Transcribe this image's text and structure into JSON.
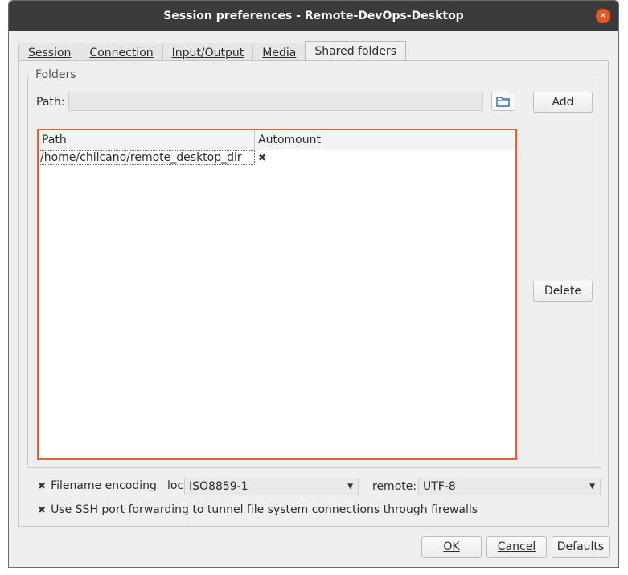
{
  "window": {
    "title": "Session preferences - Remote-DevOps-Desktop",
    "close_glyph": "✕"
  },
  "tabs": [
    {
      "label": "Session",
      "active": false
    },
    {
      "label": "Connection",
      "active": false
    },
    {
      "label": "Input/Output",
      "active": false
    },
    {
      "label": "Media",
      "active": false
    },
    {
      "label": "Shared folders",
      "active": true
    }
  ],
  "folders": {
    "group_label": "Folders",
    "path_label": "Path:",
    "path_value": "",
    "add_label": "Add",
    "delete_label": "Delete",
    "table": {
      "columns": [
        "Path",
        "Automount"
      ],
      "rows": [
        {
          "path": "/home/chilcano/remote_desktop_dir",
          "automount": "✖"
        }
      ]
    }
  },
  "encoding": {
    "checkbox_glyph": "✖",
    "label": "Filename encoding",
    "local_label": "local:",
    "local_value": "ISO8859-1",
    "remote_label": "remote:",
    "remote_value": "UTF-8",
    "arrow_glyph": "▼"
  },
  "ssh": {
    "checkbox_glyph": "✖",
    "label": "Use SSH port forwarding to tunnel file system connections through firewalls"
  },
  "buttons": {
    "ok": "OK",
    "cancel": "Cancel",
    "defaults": "Defaults"
  },
  "colors": {
    "accent": "#e0643a",
    "close": "#e95420",
    "titlebar": "#3b3b3b"
  }
}
